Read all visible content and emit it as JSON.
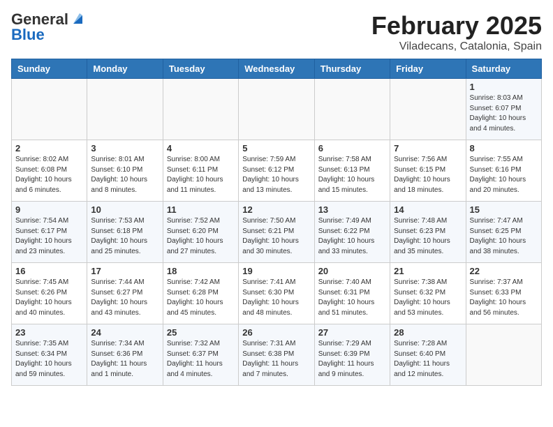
{
  "logo": {
    "general": "General",
    "blue": "Blue"
  },
  "header": {
    "title": "February 2025",
    "subtitle": "Viladecans, Catalonia, Spain"
  },
  "weekdays": [
    "Sunday",
    "Monday",
    "Tuesday",
    "Wednesday",
    "Thursday",
    "Friday",
    "Saturday"
  ],
  "weeks": [
    [
      {
        "day": "",
        "info": ""
      },
      {
        "day": "",
        "info": ""
      },
      {
        "day": "",
        "info": ""
      },
      {
        "day": "",
        "info": ""
      },
      {
        "day": "",
        "info": ""
      },
      {
        "day": "",
        "info": ""
      },
      {
        "day": "1",
        "info": "Sunrise: 8:03 AM\nSunset: 6:07 PM\nDaylight: 10 hours\nand 4 minutes."
      }
    ],
    [
      {
        "day": "2",
        "info": "Sunrise: 8:02 AM\nSunset: 6:08 PM\nDaylight: 10 hours\nand 6 minutes."
      },
      {
        "day": "3",
        "info": "Sunrise: 8:01 AM\nSunset: 6:10 PM\nDaylight: 10 hours\nand 8 minutes."
      },
      {
        "day": "4",
        "info": "Sunrise: 8:00 AM\nSunset: 6:11 PM\nDaylight: 10 hours\nand 11 minutes."
      },
      {
        "day": "5",
        "info": "Sunrise: 7:59 AM\nSunset: 6:12 PM\nDaylight: 10 hours\nand 13 minutes."
      },
      {
        "day": "6",
        "info": "Sunrise: 7:58 AM\nSunset: 6:13 PM\nDaylight: 10 hours\nand 15 minutes."
      },
      {
        "day": "7",
        "info": "Sunrise: 7:56 AM\nSunset: 6:15 PM\nDaylight: 10 hours\nand 18 minutes."
      },
      {
        "day": "8",
        "info": "Sunrise: 7:55 AM\nSunset: 6:16 PM\nDaylight: 10 hours\nand 20 minutes."
      }
    ],
    [
      {
        "day": "9",
        "info": "Sunrise: 7:54 AM\nSunset: 6:17 PM\nDaylight: 10 hours\nand 23 minutes."
      },
      {
        "day": "10",
        "info": "Sunrise: 7:53 AM\nSunset: 6:18 PM\nDaylight: 10 hours\nand 25 minutes."
      },
      {
        "day": "11",
        "info": "Sunrise: 7:52 AM\nSunset: 6:20 PM\nDaylight: 10 hours\nand 27 minutes."
      },
      {
        "day": "12",
        "info": "Sunrise: 7:50 AM\nSunset: 6:21 PM\nDaylight: 10 hours\nand 30 minutes."
      },
      {
        "day": "13",
        "info": "Sunrise: 7:49 AM\nSunset: 6:22 PM\nDaylight: 10 hours\nand 33 minutes."
      },
      {
        "day": "14",
        "info": "Sunrise: 7:48 AM\nSunset: 6:23 PM\nDaylight: 10 hours\nand 35 minutes."
      },
      {
        "day": "15",
        "info": "Sunrise: 7:47 AM\nSunset: 6:25 PM\nDaylight: 10 hours\nand 38 minutes."
      }
    ],
    [
      {
        "day": "16",
        "info": "Sunrise: 7:45 AM\nSunset: 6:26 PM\nDaylight: 10 hours\nand 40 minutes."
      },
      {
        "day": "17",
        "info": "Sunrise: 7:44 AM\nSunset: 6:27 PM\nDaylight: 10 hours\nand 43 minutes."
      },
      {
        "day": "18",
        "info": "Sunrise: 7:42 AM\nSunset: 6:28 PM\nDaylight: 10 hours\nand 45 minutes."
      },
      {
        "day": "19",
        "info": "Sunrise: 7:41 AM\nSunset: 6:30 PM\nDaylight: 10 hours\nand 48 minutes."
      },
      {
        "day": "20",
        "info": "Sunrise: 7:40 AM\nSunset: 6:31 PM\nDaylight: 10 hours\nand 51 minutes."
      },
      {
        "day": "21",
        "info": "Sunrise: 7:38 AM\nSunset: 6:32 PM\nDaylight: 10 hours\nand 53 minutes."
      },
      {
        "day": "22",
        "info": "Sunrise: 7:37 AM\nSunset: 6:33 PM\nDaylight: 10 hours\nand 56 minutes."
      }
    ],
    [
      {
        "day": "23",
        "info": "Sunrise: 7:35 AM\nSunset: 6:34 PM\nDaylight: 10 hours\nand 59 minutes."
      },
      {
        "day": "24",
        "info": "Sunrise: 7:34 AM\nSunset: 6:36 PM\nDaylight: 11 hours\nand 1 minute."
      },
      {
        "day": "25",
        "info": "Sunrise: 7:32 AM\nSunset: 6:37 PM\nDaylight: 11 hours\nand 4 minutes."
      },
      {
        "day": "26",
        "info": "Sunrise: 7:31 AM\nSunset: 6:38 PM\nDaylight: 11 hours\nand 7 minutes."
      },
      {
        "day": "27",
        "info": "Sunrise: 7:29 AM\nSunset: 6:39 PM\nDaylight: 11 hours\nand 9 minutes."
      },
      {
        "day": "28",
        "info": "Sunrise: 7:28 AM\nSunset: 6:40 PM\nDaylight: 11 hours\nand 12 minutes."
      },
      {
        "day": "",
        "info": ""
      }
    ]
  ]
}
